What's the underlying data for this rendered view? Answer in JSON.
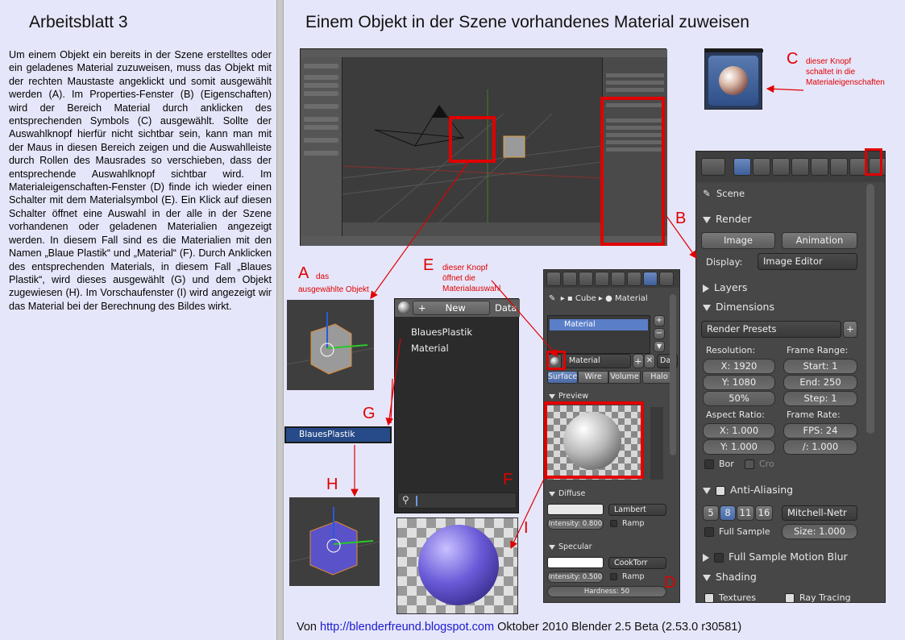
{
  "left": {
    "title": "Arbeitsblatt 3",
    "text": "Um einem Objekt ein bereits in der Szene erstelltes oder ein geladenes Material zuzuweisen, muss das Objekt mit der rechten Maustaste angeklickt und somit ausgewählt werden (A). Im Properties-Fenster (B) (Eigenschaften) wird der Bereich Material durch anklicken des entsprechenden Symbols (C) ausgewählt. Sollte der Auswahlknopf hierfür nicht sichtbar sein, kann man mit der Maus in diesen Bereich zeigen und die Auswahlleiste durch Rollen des Mausrades so verschieben, dass der entsprechende Auswahlknopf sichtbar wird. Im Materialeigenschaften-Fenster (D) finde ich wieder einen Schalter mit dem Materialsymbol (E). Ein Klick auf diesen Schalter öffnet eine Auswahl in der alle in der Szene vorhandenen oder geladenen Materialien angezeigt werden. In diesem Fall sind es die Materialien mit den Namen „Blaue Plastik“ und „Material“ (F). Durch Anklicken des entsprechenden Materials, in diesem Fall „Blaues Plastik“, wird dieses ausgewählt (G) und dem Objekt zugewiesen (H). Im Vorschaufenster (I) wird angezeigt wir das Material bei der Berechnung des Bildes wirkt."
  },
  "right": {
    "title": "Einem Objekt in der Szene vorhandenes Material zuweisen",
    "labels": {
      "a": "A",
      "a_note1": "das",
      "a_note2": "ausgewählte Objekt",
      "b": "B",
      "c": "C",
      "c_note1": "dieser Knopf",
      "c_note2": "schaltet in die",
      "c_note3": "Materialeigenschaften",
      "d": "D",
      "e": "E",
      "e_note1": "dieser Knopf",
      "e_note2": "öffnet die",
      "e_note3": "Materialauswahl",
      "f": "F",
      "g": "G",
      "h": "H",
      "i": "I"
    },
    "footer": {
      "prefix": "Von ",
      "link": "http://blenderfreund.blogspot.com",
      "suffix": " Oktober 2010 Blender 2.5 Beta (2.53.0 r30581)"
    },
    "colors": {
      "accent_red": "#e00000",
      "link_blue": "#0000ee"
    }
  },
  "render_panel": {
    "scene": "Scene",
    "render_header": "Render",
    "image_btn": "Image",
    "animation_btn": "Animation",
    "display_label": "Display:",
    "display_value": "Image Editor",
    "layers": "Layers",
    "dimensions": "Dimensions",
    "render_presets": "Render Presets",
    "resolution": "Resolution:",
    "frame_range": "Frame Range:",
    "res_x": "X: 1920",
    "res_y": "Y: 1080",
    "res_pct": "50%",
    "start": "Start: 1",
    "end": "End: 250",
    "step": "Step: 1",
    "aspect": "Aspect Ratio:",
    "frame_rate": "Frame Rate:",
    "asp_x": "X: 1.000",
    "asp_y": "Y: 1.000",
    "fps": "FPS: 24",
    "fps_base": "/: 1.000",
    "bor": "Bor",
    "cro": "Cro",
    "anti_aliasing": "Anti-Aliasing",
    "aa_5": "5",
    "aa_8": "8",
    "aa_11": "11",
    "aa_16": "16",
    "filter": "Mitchell-Netr",
    "full_sample": "Full Sample",
    "size": "Size: 1.000",
    "full_sample_motion_blur": "Full Sample Motion Blur",
    "shading": "Shading",
    "textures": "Textures",
    "ray_tracing": "Ray Tracing"
  },
  "material_panel": {
    "crumb_cube": "Cube",
    "crumb_material": "Material",
    "slot": "Material",
    "mat_field": "Material",
    "data_btn": "Da",
    "tab_surface": "Surface",
    "tab_wire": "Wire",
    "tab_volume": "Volume",
    "tab_halo": "Halo",
    "preview": "Preview",
    "diffuse": "Diffuse",
    "diffuse_shader": "Lambert",
    "intensity_d": "Intensity: 0.800",
    "ramp": "Ramp",
    "specular": "Specular",
    "specular_shader": "CookTorr",
    "intensity_s": "Intensity: 0.500",
    "hardness": "Hardness: 50"
  },
  "material_list": {
    "new_btn": "New",
    "data_tab": "Data",
    "items": [
      "BlauesPlastik",
      "Material"
    ],
    "selected": "BlauesPlastik"
  }
}
